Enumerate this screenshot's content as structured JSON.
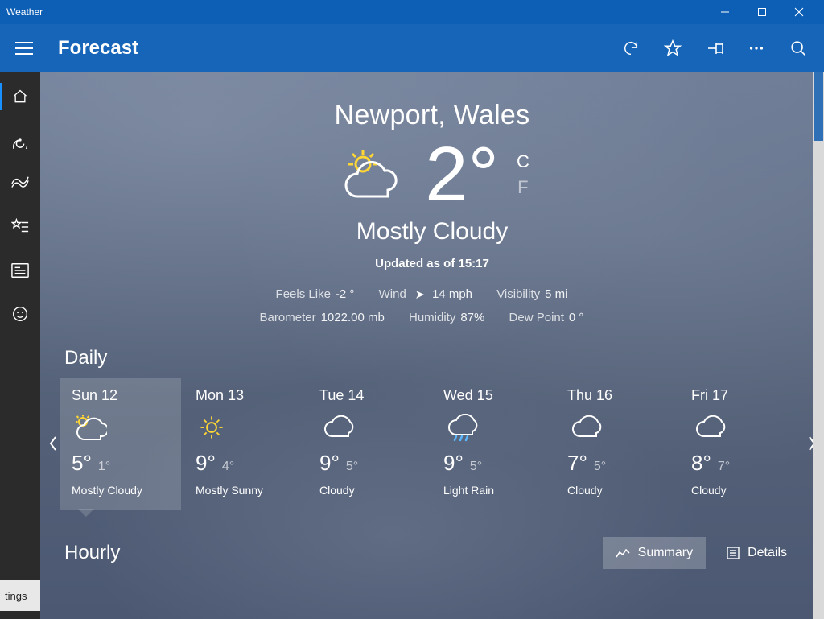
{
  "window": {
    "title": "Weather"
  },
  "cmdbar": {
    "title": "Forecast"
  },
  "hero": {
    "location": "Newport, Wales",
    "temp": "2°",
    "unit_c": "C",
    "unit_f": "F",
    "description": "Mostly Cloudy",
    "updated": "Updated as of 15:17",
    "metrics_line1": {
      "feels_lbl": "Feels Like",
      "feels_val": "-2 °",
      "wind_lbl": "Wind",
      "wind_val": "14 mph",
      "vis_lbl": "Visibility",
      "vis_val": "5 mi"
    },
    "metrics_line2": {
      "baro_lbl": "Barometer",
      "baro_val": "1022.00 mb",
      "hum_lbl": "Humidity",
      "hum_val": "87%",
      "dew_lbl": "Dew Point",
      "dew_val": "0 °"
    }
  },
  "sections": {
    "daily": "Daily",
    "hourly": "Hourly"
  },
  "daily": [
    {
      "day": "Sun 12",
      "hi": "5°",
      "lo": "1°",
      "cond": "Mostly Cloudy",
      "icon": "partly-cloudy"
    },
    {
      "day": "Mon 13",
      "hi": "9°",
      "lo": "4°",
      "cond": "Mostly Sunny",
      "icon": "sunny"
    },
    {
      "day": "Tue 14",
      "hi": "9°",
      "lo": "5°",
      "cond": "Cloudy",
      "icon": "cloudy"
    },
    {
      "day": "Wed 15",
      "hi": "9°",
      "lo": "5°",
      "cond": "Light Rain",
      "icon": "rain"
    },
    {
      "day": "Thu 16",
      "hi": "7°",
      "lo": "5°",
      "cond": "Cloudy",
      "icon": "cloudy"
    },
    {
      "day": "Fri 17",
      "hi": "8°",
      "lo": "7°",
      "cond": "Cloudy",
      "icon": "cloudy"
    }
  ],
  "hourly_tabs": {
    "summary": "Summary",
    "details": "Details"
  },
  "settings": {
    "partial": "tings"
  }
}
